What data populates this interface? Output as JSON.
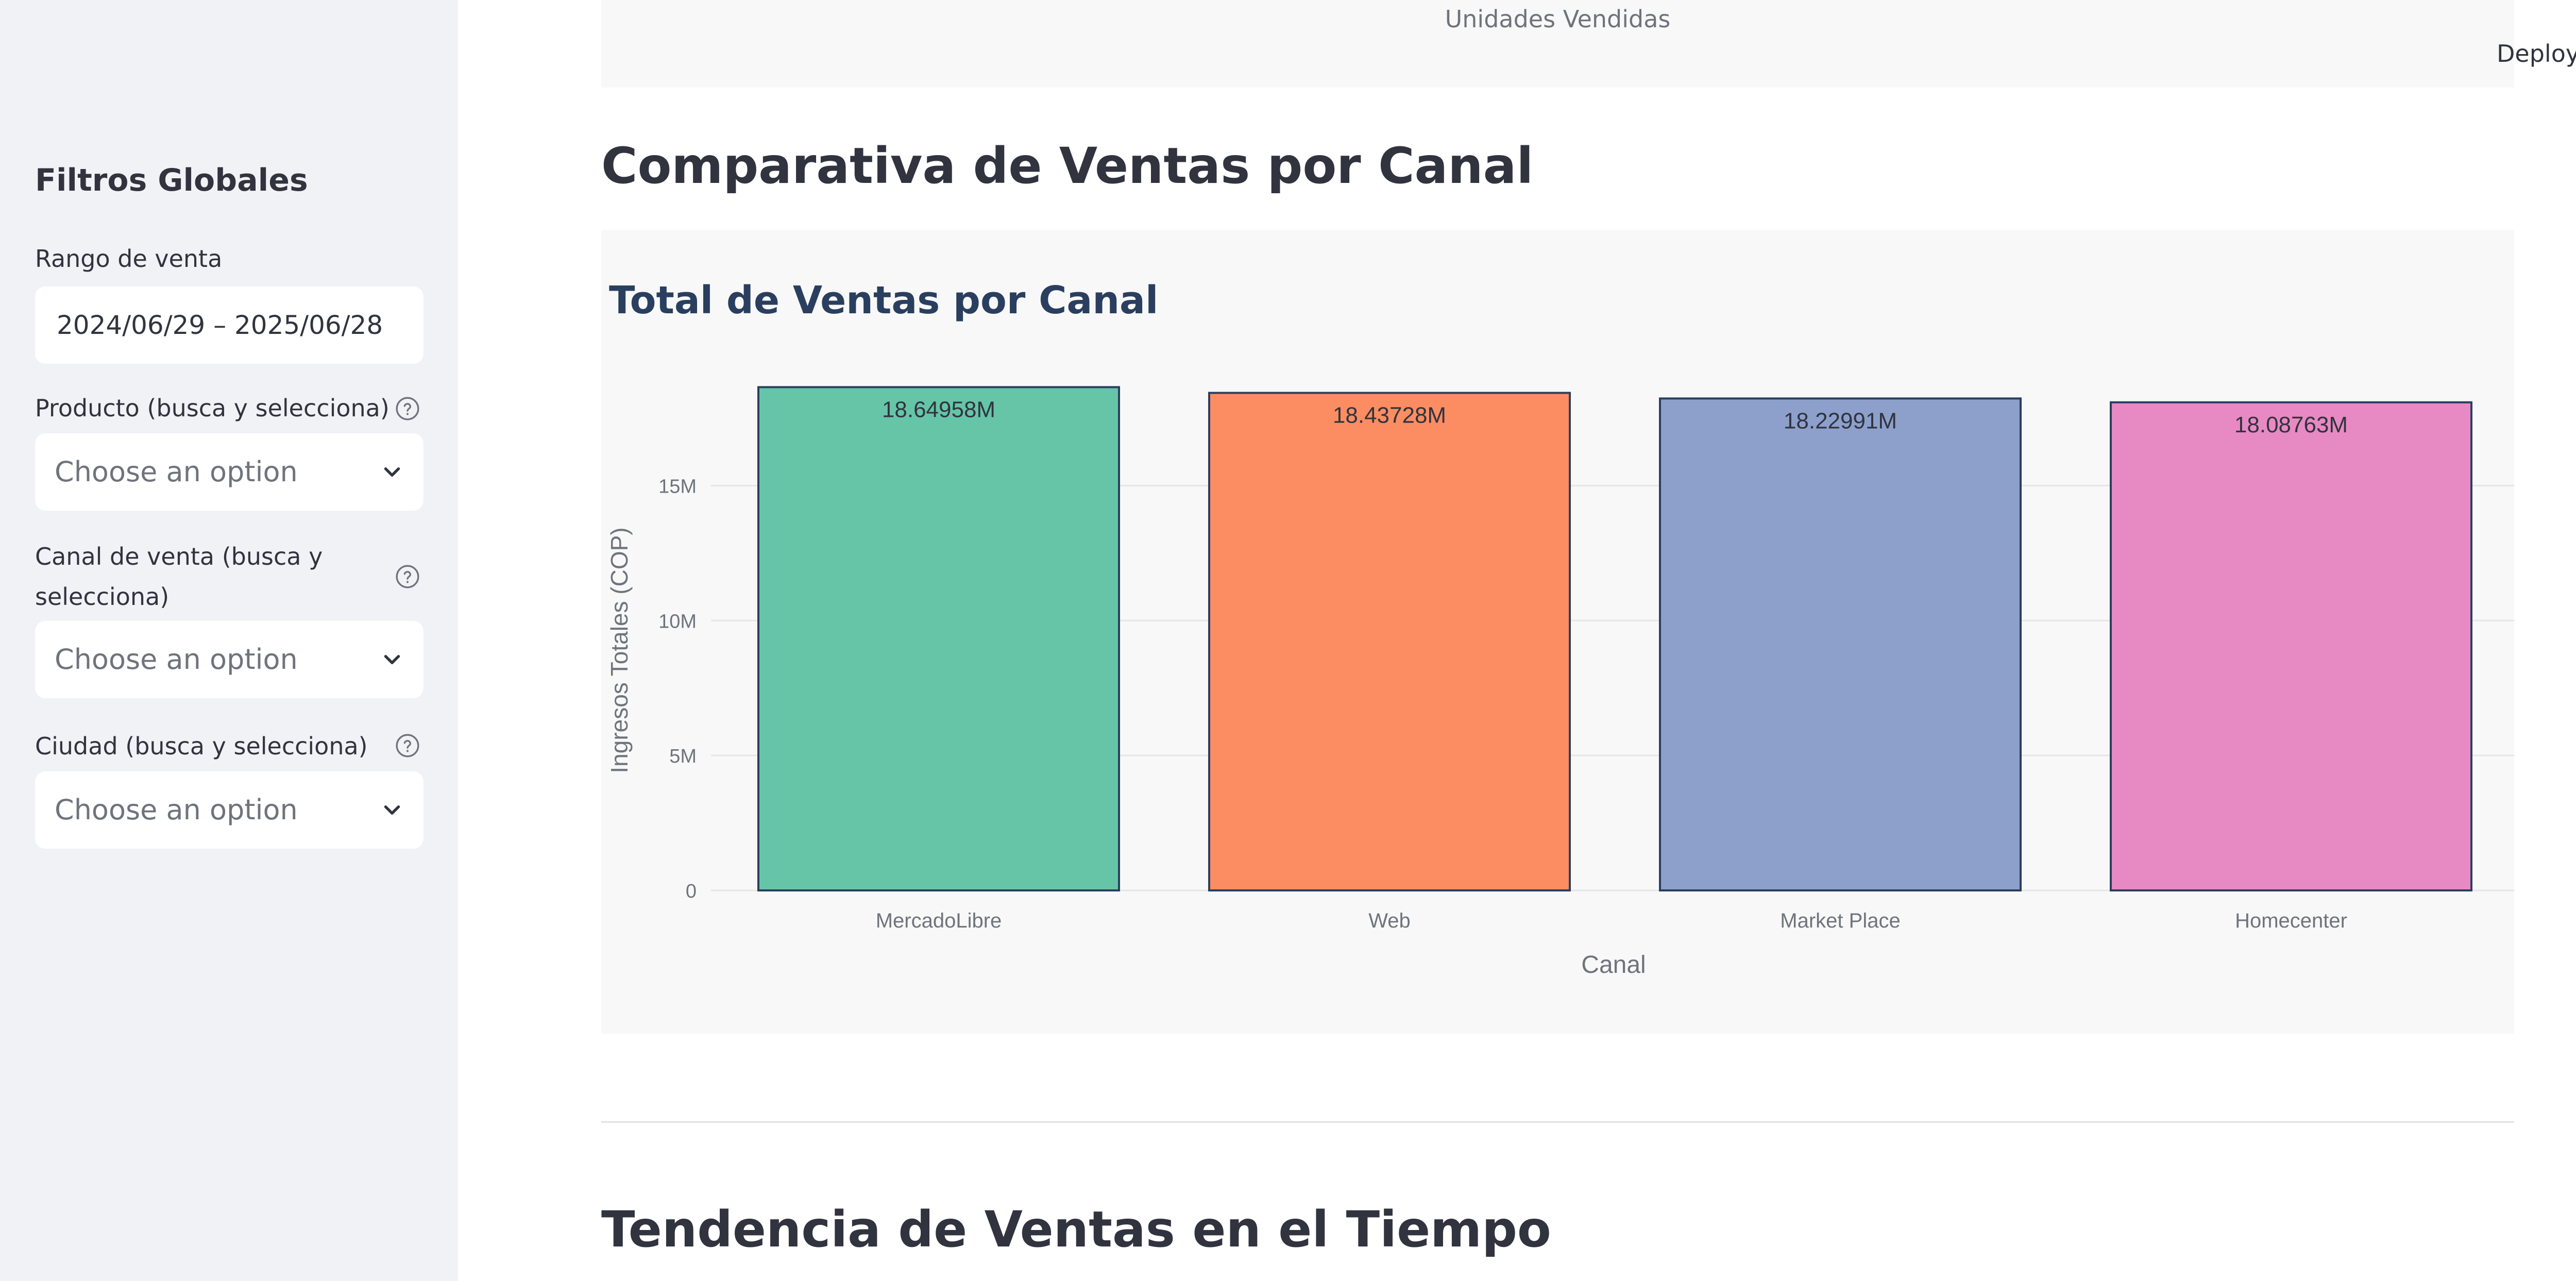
{
  "sidebar": {
    "title": "Filtros Globales",
    "date_range": {
      "label": "Rango de venta",
      "value": "2024/06/29 – 2025/06/28"
    },
    "product": {
      "label": "Producto (busca y selecciona)",
      "placeholder": "Choose an option"
    },
    "channel": {
      "label_line1": "Canal de venta (busca y",
      "label_line2": "selecciona)",
      "placeholder": "Choose an option"
    },
    "city": {
      "label": "Ciudad (busca y selecciona)",
      "placeholder": "Choose an option"
    }
  },
  "header": {
    "deploy_label": "Deploy"
  },
  "main": {
    "top_card_text": "Unidades Vendidas",
    "section1_title": "Comparativa de Ventas por Canal",
    "section2_title": "Tendencia de Ventas en el Tiempo"
  },
  "chart_data": {
    "type": "bar",
    "title": "Total de Ventas por Canal",
    "xlabel": "Canal",
    "ylabel": "Ingresos Totales (COP)",
    "categories": [
      "MercadoLibre",
      "Web",
      "Market Place",
      "Homecenter"
    ],
    "values": [
      18649580,
      18437280,
      18229910,
      18087630
    ],
    "data_labels": [
      "18.64958M",
      "18.43728M",
      "18.22991M",
      "18.08763M"
    ],
    "colors": [
      "#66c5a7",
      "#fc8d62",
      "#8da0cb",
      "#e78ac3"
    ],
    "yticks": [
      0,
      5000000,
      10000000,
      15000000
    ],
    "ytick_labels": [
      "0",
      "5M",
      "10M",
      "15M"
    ],
    "ylim": [
      0,
      19630000
    ],
    "grid": true
  }
}
